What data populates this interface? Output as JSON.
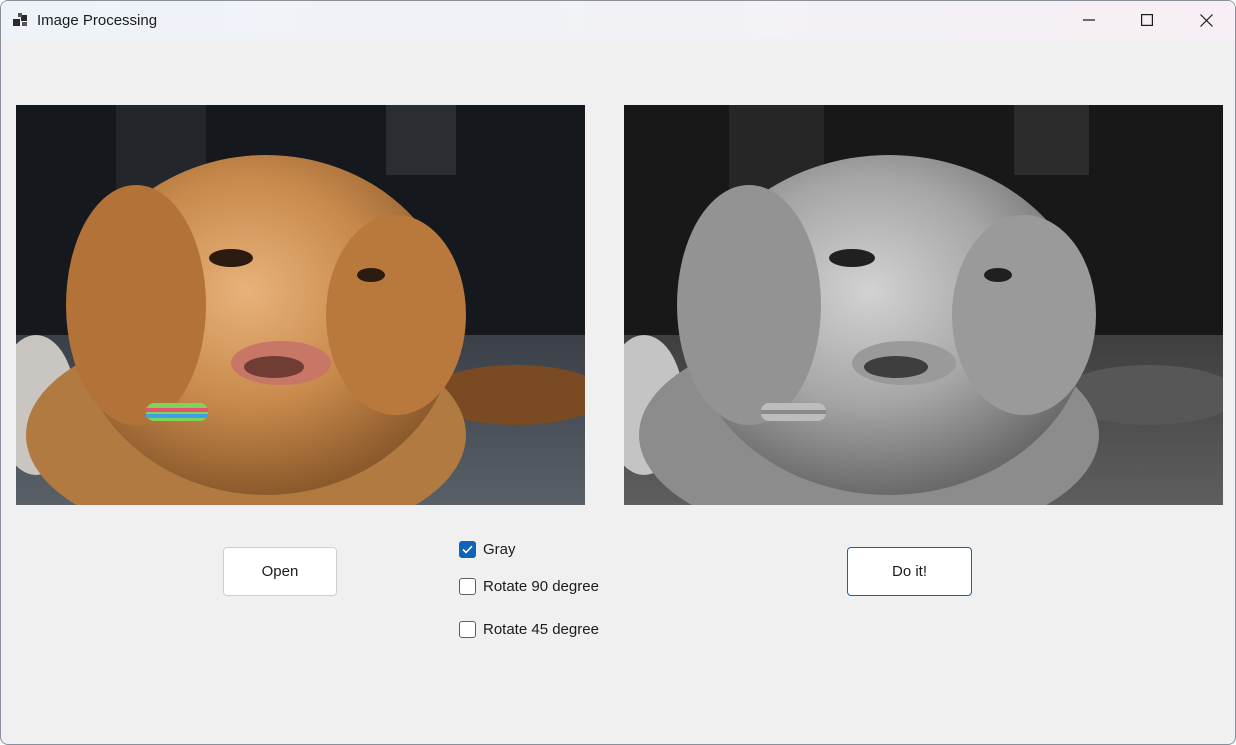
{
  "window": {
    "title": "Image Processing",
    "app_icon": "app-windows-icon",
    "controls": {
      "minimize_icon": "minimize-icon",
      "maximize_icon": "maximize-icon",
      "close_icon": "close-icon"
    }
  },
  "images": {
    "original": {
      "description_icon": "dog-photo-color"
    },
    "processed": {
      "description_icon": "dog-photo-grayscale"
    }
  },
  "controls": {
    "open_label": "Open",
    "doit_label": "Do it!",
    "options": [
      {
        "label": "Gray",
        "checked": true
      },
      {
        "label": "Rotate 90 degree",
        "checked": false
      },
      {
        "label": "Rotate 45 degree",
        "checked": false
      }
    ]
  },
  "colors": {
    "accent": "#0f63b8",
    "window_bg": "#f0f0f0"
  }
}
